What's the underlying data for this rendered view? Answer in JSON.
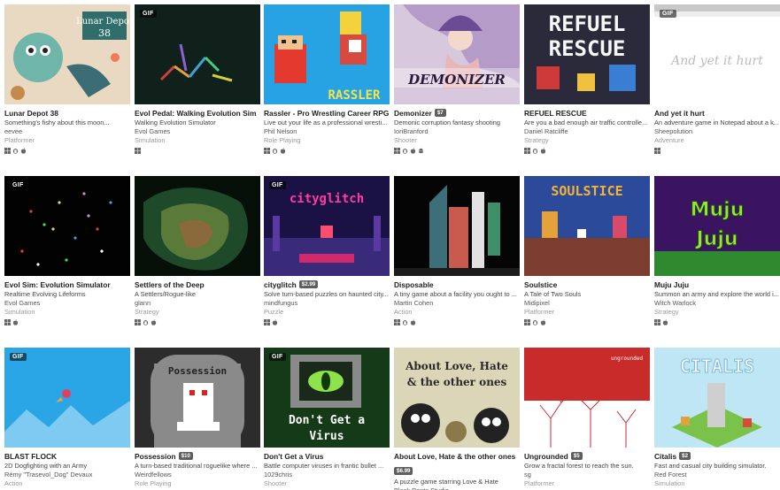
{
  "games": [
    {
      "title": "Lunar Depot 38",
      "desc": "Something's fishy about this moon...",
      "author": "eevee",
      "genre": "Platformer",
      "platforms": [
        "windows-icon",
        "linux-icon",
        "mac-icon"
      ],
      "gif": false,
      "price": "",
      "thumb_text": "Lunar Depot 38"
    },
    {
      "title": "Evol Pedal: Walking Evolution Sim",
      "desc": "Walking Evolution Simulator",
      "author": "Evol Games",
      "genre": "Simulation",
      "platforms": [
        "windows-icon"
      ],
      "gif": true,
      "price": "",
      "thumb_text": ""
    },
    {
      "title": "Rassler - Pro Wrestling Career RPG",
      "desc": "Live out your life as a professional wresti...",
      "author": "Phil Nelson",
      "genre": "Role Playing",
      "platforms": [
        "windows-icon",
        "linux-icon",
        "mac-icon"
      ],
      "gif": false,
      "price": "",
      "thumb_text": "RASSLER"
    },
    {
      "title": "Demonizer",
      "desc": "Demonic corruption fantasy shooting",
      "author": "IoriBranford",
      "genre": "Shooter",
      "platforms": [
        "windows-icon",
        "linux-icon",
        "mac-icon",
        "android-icon"
      ],
      "gif": false,
      "price": "$7",
      "thumb_text": "DEMONIZER"
    },
    {
      "title": "REFUEL RESCUE",
      "desc": "Are you a bad enough air traffic controlle...",
      "author": "Daniel Ratcliffe",
      "genre": "Strategy",
      "platforms": [
        "windows-icon",
        "linux-icon",
        "mac-icon"
      ],
      "gif": false,
      "price": "",
      "thumb_text": "REFUEL RESCUE"
    },
    {
      "title": "And yet it hurt",
      "desc": "An adventure game in Notepad about a k...",
      "author": "Sheepolution",
      "genre": "Adventure",
      "platforms": [
        "windows-icon"
      ],
      "gif": true,
      "price": "",
      "thumb_text": "And yet it hurt"
    },
    {
      "title": "Evol Sim: Evolution Simulator",
      "desc": "Realtime Evolving Lifeforms",
      "author": "Evol Games",
      "genre": "Simulation",
      "platforms": [
        "windows-icon",
        "mac-icon"
      ],
      "gif": true,
      "price": "",
      "thumb_text": ""
    },
    {
      "title": "Settlers of the Deep",
      "desc": "A Settlers/Rogue-like",
      "author": "glann",
      "genre": "Strategy",
      "platforms": [
        "windows-icon",
        "linux-icon",
        "mac-icon"
      ],
      "gif": false,
      "price": "",
      "thumb_text": ""
    },
    {
      "title": "cityglitch",
      "desc": "Solve turn-based puzzles on haunted city...",
      "author": "mindfungus",
      "genre": "Puzzle",
      "platforms": [
        "windows-icon",
        "mac-icon"
      ],
      "gif": true,
      "price": "$2.99",
      "thumb_text": "cityglitch"
    },
    {
      "title": "Disposable",
      "desc": "A tiny game about a facility you ought to ...",
      "author": "Martin Cohen",
      "genre": "Action",
      "platforms": [
        "windows-icon",
        "linux-icon",
        "mac-icon"
      ],
      "gif": false,
      "price": "",
      "thumb_text": ""
    },
    {
      "title": "Soulstice",
      "desc": "A Tale of Two Souls",
      "author": "Midipixel",
      "genre": "Platformer",
      "platforms": [
        "windows-icon",
        "linux-icon",
        "mac-icon"
      ],
      "gif": false,
      "price": "",
      "thumb_text": "SOULSTICE"
    },
    {
      "title": "Muju Juju",
      "desc": "Summon an army and explore the world i...",
      "author": "Witch Warlock",
      "genre": "Strategy",
      "platforms": [
        "windows-icon",
        "mac-icon"
      ],
      "gif": false,
      "price": "",
      "thumb_text": "Muju Juju"
    },
    {
      "title": "BLAST FLOCK",
      "desc": "2D Dogfighting with an Army",
      "author": "Rémy \"Trasevol_Dog\" Devaux",
      "genre": "Action",
      "platforms": [],
      "gif": true,
      "price": "",
      "thumb_text": ""
    },
    {
      "title": "Possession",
      "desc": "A turn-based traditional roguelike where ...",
      "author": "Weirdfellows",
      "genre": "Role Playing",
      "platforms": [],
      "gif": false,
      "price": "$10",
      "thumb_text": "Possession"
    },
    {
      "title": "Don't Get a Virus",
      "desc": "Battle computer viruses in frantic bullet ...",
      "author": "1029chris",
      "genre": "Shooter",
      "platforms": [],
      "gif": true,
      "price": "",
      "thumb_text": "Don't Get a Virus"
    },
    {
      "title": "About Love, Hate & the other ones",
      "desc": "A puzzle game starring Love & Hate",
      "author": "Black Pants Studio",
      "genre": "",
      "platforms": [],
      "gif": false,
      "price": "$6.99",
      "thumb_text": "About Love, Hate & the other ones"
    },
    {
      "title": "Ungrounded",
      "desc": "Grow a fractal forest to reach the sun.",
      "author": "sg",
      "genre": "Platformer",
      "platforms": [],
      "gif": false,
      "price": "$5",
      "thumb_text": "ungrounded"
    },
    {
      "title": "Citalis",
      "desc": "Fast and casual city building simulator.",
      "author": "Red Forest",
      "genre": "Simulation",
      "platforms": [],
      "gif": false,
      "price": "$2",
      "thumb_text": "CITALIS"
    }
  ],
  "gif_label": "GIF",
  "colors": {
    "price_badge": "#5e5e5e",
    "genre": "#9a9a9a"
  }
}
